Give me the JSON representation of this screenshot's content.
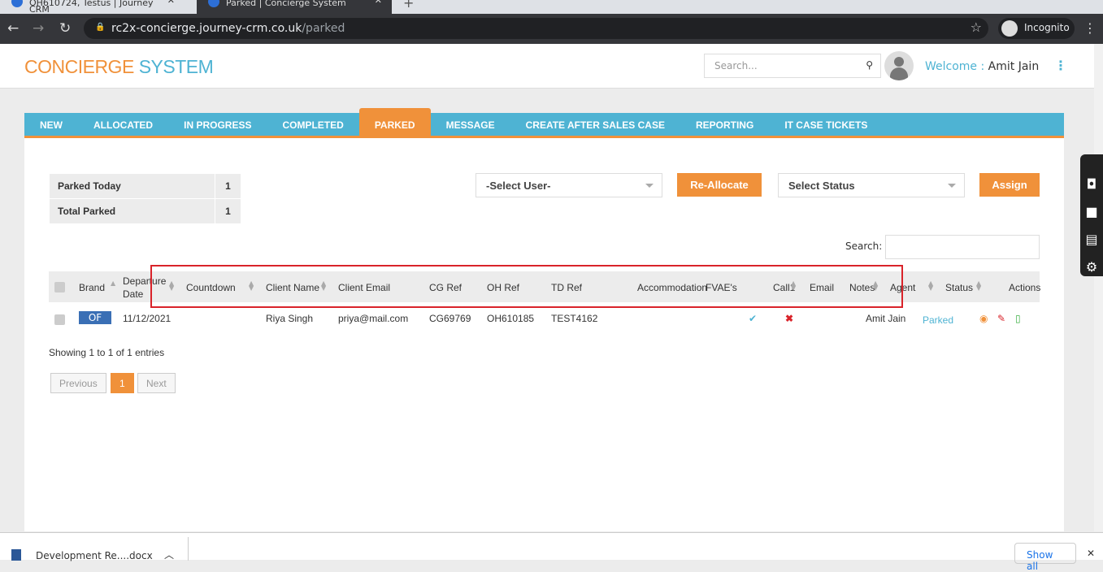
{
  "browser": {
    "tabs": [
      {
        "title": "OH610724, Testus | Journey CRM"
      },
      {
        "title": "Parked | Concierge System"
      }
    ],
    "url_host": "rc2x-concierge.journey-crm.co.uk",
    "url_path": "/parked",
    "profile": "Incognito"
  },
  "header": {
    "logo_a": "CONCIERGE",
    "logo_b": "SYSTEM",
    "search_placeholder": "Search...",
    "welcome_label": "Welcome :",
    "user": "Amit Jain"
  },
  "menu": [
    {
      "label": "NEW"
    },
    {
      "label": "ALLOCATED"
    },
    {
      "label": "IN PROGRESS"
    },
    {
      "label": "COMPLETED"
    },
    {
      "label": "PARKED",
      "active": true
    },
    {
      "label": "MESSAGE"
    },
    {
      "label": "CREATE AFTER SALES CASE"
    },
    {
      "label": "REPORTING"
    },
    {
      "label": "IT CASE TICKETS"
    }
  ],
  "stats": [
    {
      "label": "Parked Today",
      "value": "1"
    },
    {
      "label": "Total Parked",
      "value": "1"
    }
  ],
  "controls": {
    "select_user": "-Select User-",
    "reallocate": "Re-Allocate",
    "select_status": "Select Status",
    "assign": "Assign",
    "search_label": "Search:"
  },
  "table": {
    "columns": [
      "Brand",
      "Departure",
      "Date",
      "Countdown",
      "Client Name",
      "Client Email",
      "CG Ref",
      "OH Ref",
      "TD Ref",
      "Accommodation",
      "FVAE's",
      "Call1",
      "Email",
      "Notes",
      "Agent",
      "Status",
      "Actions"
    ],
    "rows": [
      {
        "brand": "OF",
        "departure_date": "11/12/2021",
        "countdown": "",
        "client_name": "Riya Singh",
        "client_email": "priya@mail.com",
        "cg_ref": "CG69769",
        "oh_ref": "OH610185",
        "td_ref": "TEST4162",
        "accommodation": "",
        "fvaes": "",
        "call1": "check",
        "email": "cross",
        "notes": "",
        "agent": "Amit Jain",
        "status": "Parked"
      }
    ]
  },
  "info": "Showing 1 to 1 of 1 entries",
  "pagination": {
    "previous": "Previous",
    "current": "1",
    "next": "Next"
  },
  "downloads": {
    "file": "Development Re....docx",
    "show_all": "Show all"
  },
  "colors": {
    "accent_orange": "#f0913a",
    "accent_blue": "#4eb3d3",
    "highlight": "#d9232a"
  }
}
